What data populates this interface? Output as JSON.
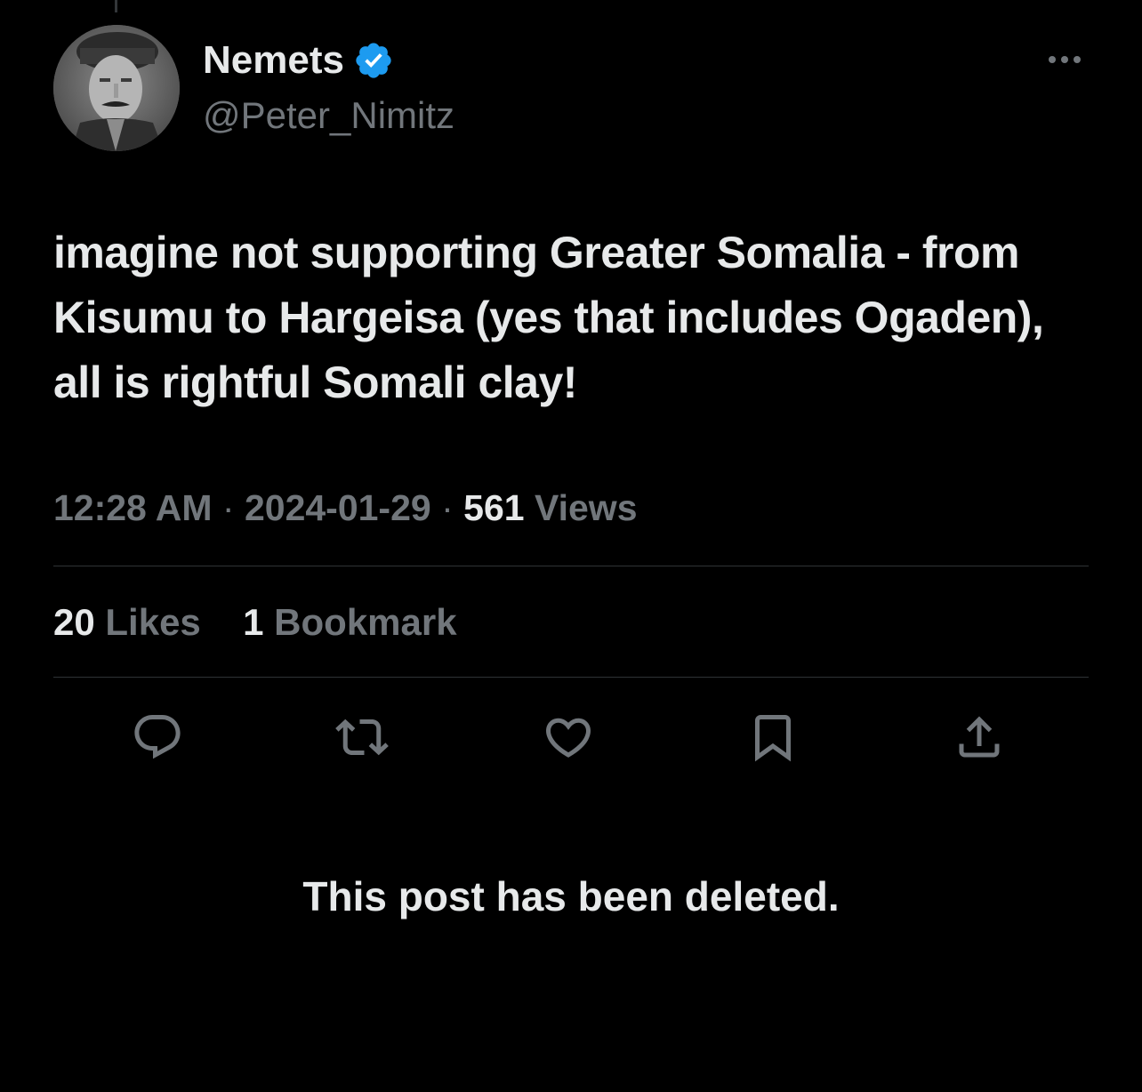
{
  "author": {
    "display_name": "Nemets",
    "handle": "@Peter_Nimitz",
    "verified": true,
    "avatar_icon": "avatar-portrait-photo"
  },
  "post": {
    "text": "imagine not supporting Greater Somalia - from Kisumu to Hargeisa (yes that includes Ogaden), all is rightful Somali clay!",
    "time": "12:28 AM",
    "separator": "·",
    "date": "2024-01-29",
    "views_count": "561",
    "views_label": "Views"
  },
  "stats": {
    "likes_count": "20",
    "likes_label": "Likes",
    "bookmarks_count": "1",
    "bookmarks_label": "Bookmark"
  },
  "actions": {
    "reply_icon": "reply-icon",
    "repost_icon": "repost-icon",
    "like_icon": "heart-icon",
    "bookmark_icon": "bookmark-icon",
    "share_icon": "share-icon"
  },
  "notice": {
    "text": "This post has been deleted."
  },
  "colors": {
    "background": "#000000",
    "primary_text": "#e7e9ea",
    "secondary_text": "#71767b",
    "divider": "#2f3336",
    "verified_badge": "#1d9bf0"
  }
}
